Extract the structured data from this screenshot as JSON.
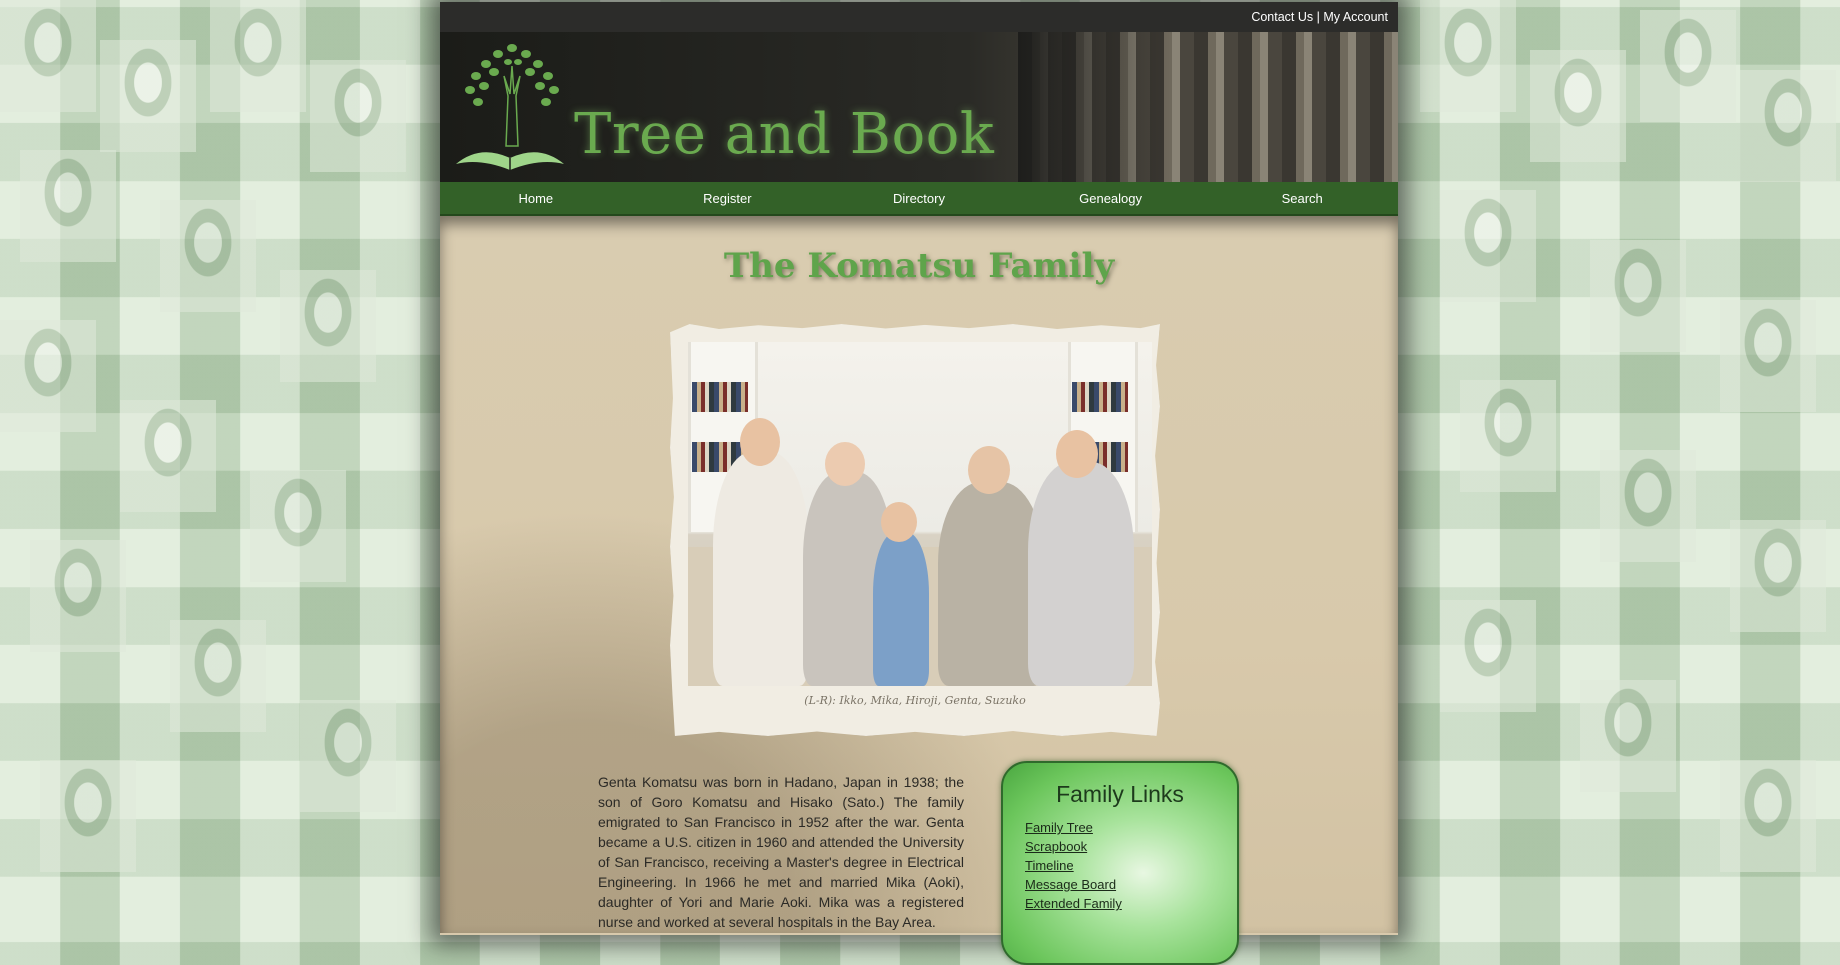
{
  "topbar": {
    "contact_label": "Contact Us",
    "separator": "|",
    "account_label": "My Account"
  },
  "header": {
    "site_title": "Tree and Book",
    "logo_icon": "tree-book-icon"
  },
  "nav": {
    "items": [
      {
        "label": "Home"
      },
      {
        "label": "Register"
      },
      {
        "label": "Directory"
      },
      {
        "label": "Genealogy"
      },
      {
        "label": "Search"
      }
    ]
  },
  "main": {
    "title": "The Komatsu Family",
    "photo_caption": "(L-R): Ikko, Mika, Hiroji, Genta, Suzuko",
    "bio": "Genta Komatsu was born in Hadano, Japan in 1938; the son of Goro Komatsu and Hisako (Sato.) The family emigrated to San Francisco in 1952 after the war. Genta became a U.S. citizen in 1960 and attended the University of San Francisco, receiving a Master's degree in Electrical Engineering. In 1966 he met and married Mika (Aoki), daughter of Yori and Marie Aoki. Mika was a registered nurse and worked at several hospitals in the Bay Area."
  },
  "family_links": {
    "title": "Family Links",
    "items": [
      {
        "label": "Family Tree"
      },
      {
        "label": "Scrapbook"
      },
      {
        "label": "Timeline"
      },
      {
        "label": "Message Board"
      },
      {
        "label": "Extended Family"
      }
    ]
  },
  "colors": {
    "accent_green": "#336128",
    "title_green": "#5fa44b",
    "page_bg": "#d8c9ac"
  }
}
